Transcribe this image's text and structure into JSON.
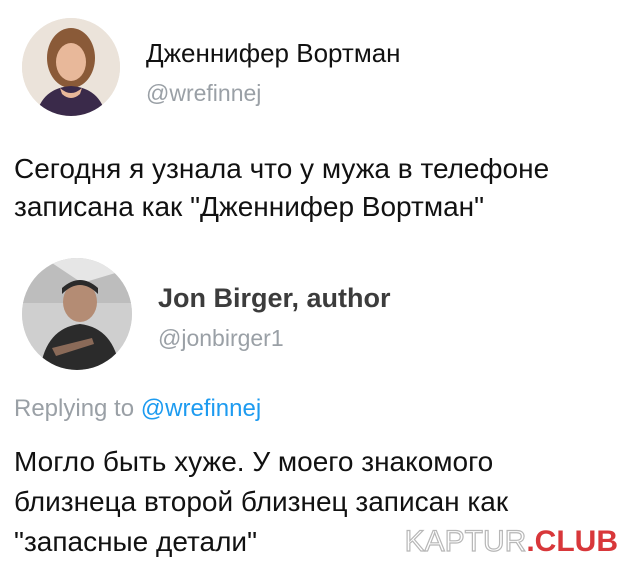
{
  "tweet": {
    "author_name": "Дженнифер Вортман",
    "author_handle": "@wrefinnej",
    "lines": [
      "Сегодня я узнала что у мужа в телефоне",
      "записана как \"Дженнифер Вортман\""
    ]
  },
  "reply": {
    "author_name": "Jon Birger, author",
    "author_handle": "@jonbirger1",
    "replying_prefix": "Replying to",
    "replying_handle": "@wrefinnej",
    "lines": [
      "Могло быть хуже. У моего знакомого",
      "близнеца второй близнец записан как",
      "\"запасные детали\""
    ]
  },
  "watermark": {
    "part1": "KAPTUR",
    "part2": ".CLUB"
  },
  "colors": {
    "muted": "#9aa0a6",
    "mention": "#1d9bf0",
    "watermark_red": "#d8373a"
  }
}
